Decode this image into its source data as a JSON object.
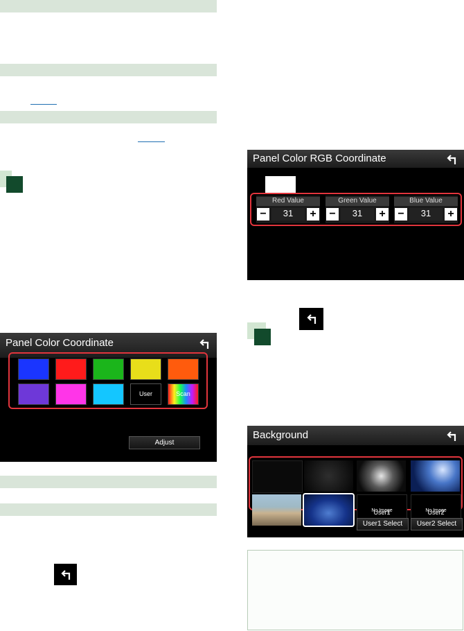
{
  "panel_color": {
    "title": "Panel Color Coordinate",
    "swatches": [
      "#1a35ff",
      "#ff1b1b",
      "#1bb51b",
      "#e8de1a",
      "#ff5b0d",
      "#6e38d8",
      "#ff35e8",
      "#14c6ff"
    ],
    "user_label": "User",
    "scan_label": "Scan",
    "adjust_label": "Adjust"
  },
  "rgb": {
    "title": "Panel Color RGB Coordinate",
    "groups": [
      {
        "label": "Red Value",
        "value": "31"
      },
      {
        "label": "Green Value",
        "value": "31"
      },
      {
        "label": "Blue Value",
        "value": "31"
      }
    ],
    "minus": "−",
    "plus": "+"
  },
  "background": {
    "title": "Background",
    "no_image": "No Image",
    "user1": "User1",
    "user2": "User2",
    "user1_select": "User1 Select",
    "user2_select": "User2 Select"
  },
  "colors": {
    "accent_red": "#e2353d",
    "section_bar": "#d9e5d9",
    "step_marker": "#124a2c"
  }
}
